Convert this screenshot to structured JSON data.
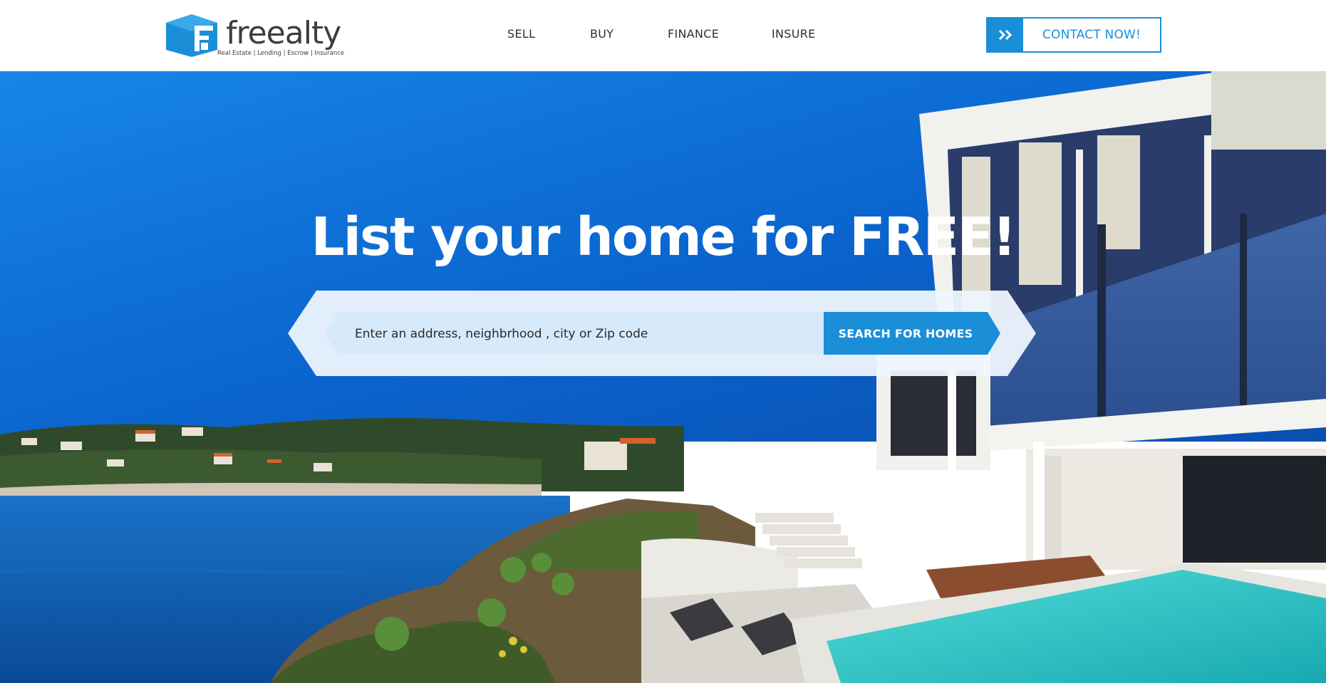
{
  "brand": {
    "name": "freealty",
    "tagline": "Real Estate | Lending | Escrow | Insurance",
    "color": "#1a8fd8"
  },
  "nav": {
    "items": [
      {
        "label": "SELL"
      },
      {
        "label": "BUY"
      },
      {
        "label": "FINANCE"
      },
      {
        "label": "INSURE"
      }
    ]
  },
  "contact": {
    "label": "CONTACT NOW!",
    "icon": "double-chevron-right-icon"
  },
  "hero": {
    "headline": "List your home for FREE!",
    "search": {
      "placeholder": "Enter an address, neighbrhood , city or Zip code",
      "value": "",
      "button_label": "SEARCH FOR HOMES"
    }
  },
  "colors": {
    "accent": "#1a8fd8",
    "sky": "#0d6ed6",
    "sea": "#0b5fb0",
    "pool": "#2ec4c4"
  }
}
